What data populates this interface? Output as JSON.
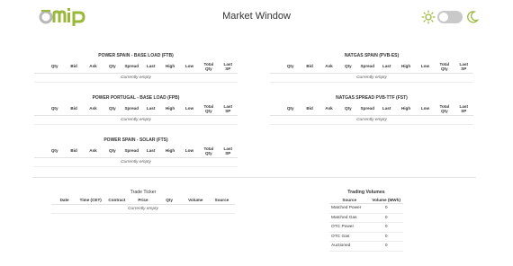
{
  "app": {
    "logo_text": "omip",
    "title": "Market Window",
    "theme_icons": [
      "sun-icon",
      "toggle-switch",
      "moon-icon"
    ],
    "accent_color": "#9ab83a"
  },
  "market_columns": [
    "Qty",
    "Bid",
    "Ask",
    "Qty",
    "Spread",
    "Last",
    "High",
    "Low",
    "Total\nQty",
    "Last\nSP"
  ],
  "panels": {
    "power_spain_base": {
      "title": "POWER SPAIN - BASE LOAD (FTB)",
      "empty": "Currently empty"
    },
    "natgas_spain": {
      "title": "NATGAS SPAIN (PVB-ES)",
      "empty": "Currently empty"
    },
    "power_portugal_base": {
      "title": "POWER PORTUGAL - BASE LOAD (FPB)",
      "empty": "Currently empty"
    },
    "natgas_spread": {
      "title": "NATGAS SPREAD PVB-TTF (FST)",
      "empty": "Currently empty"
    },
    "power_spain_solar": {
      "title": "POWER SPAIN - SOLAR (FTS)",
      "empty": "Currently empty"
    }
  },
  "trade_ticker": {
    "title": "Trade Ticker",
    "columns": [
      "Date",
      "Time (CET)",
      "Contract",
      "Price",
      "Qty",
      "Volume",
      "Source"
    ],
    "empty": "Currently empty"
  },
  "trading_volumes": {
    "title": "Trading Volumes",
    "columns": [
      "Source",
      "Volume (MWh)"
    ],
    "rows": [
      {
        "source": "Matched Power",
        "volume": "0"
      },
      {
        "source": "Matched Gas",
        "volume": "0"
      },
      {
        "source": "OTC Power",
        "volume": "0"
      },
      {
        "source": "OTC Gas",
        "volume": "0"
      },
      {
        "source": "Auctioned",
        "volume": "0"
      }
    ]
  }
}
